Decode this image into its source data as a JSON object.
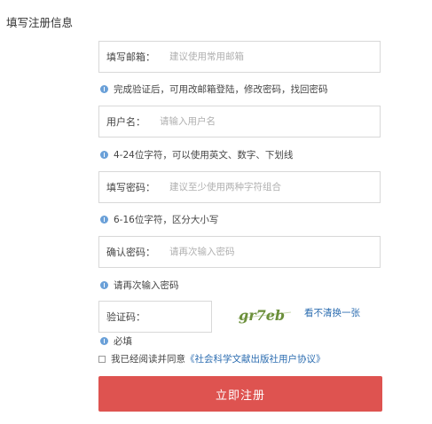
{
  "page": {
    "title": "填写注册信息"
  },
  "form": {
    "email": {
      "label": "填写邮箱：",
      "placeholder": "建议使用常用邮箱",
      "value": "",
      "hint": "完成验证后，可用改邮箱登陆，修改密码，找回密码"
    },
    "username": {
      "label": "用户名：",
      "placeholder": "请输入用户名",
      "value": "",
      "hint": "4-24位字符，可以使用英文、数字、下划线"
    },
    "password": {
      "label": "填写密码：",
      "placeholder": "建议至少使用两种字符组合",
      "value": "",
      "hint": "6-16位字符，区分大小写"
    },
    "confirm": {
      "label": "确认密码：",
      "placeholder": "请再次输入密码",
      "value": "",
      "hint": "请再次输入密码"
    },
    "captcha": {
      "label": "验证码：",
      "value": "",
      "image_text": "gr7eb",
      "refresh_label": "看不清换一张",
      "hint": "必填"
    },
    "agreement": {
      "prefix": "我已经阅读并同意",
      "link": "《社会科学文献出版社用户协议》",
      "checked": false
    },
    "submit_label": "立即注册"
  },
  "colors": {
    "submit_button": "#de5350",
    "link": "#2b6cb0",
    "info_icon": "#6aa0d8",
    "captcha_text": "#6b8f3a"
  }
}
